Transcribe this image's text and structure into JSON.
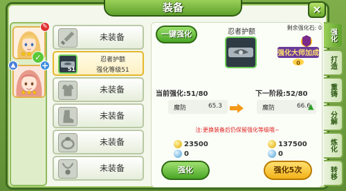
{
  "window": {
    "title": "装备",
    "close_glyph": "×"
  },
  "heroes": [
    {
      "name": "hero-1",
      "stars": "★★★"
    },
    {
      "name": "hero-2",
      "stars": "★★★"
    }
  ],
  "slots": [
    {
      "label": "未装备",
      "icon": "sword-icon"
    },
    {
      "label": "忍者护额",
      "sub": "强化等级51",
      "level": "51",
      "icon": "headband-icon",
      "selected": true
    },
    {
      "label": "未装备",
      "icon": "armor-icon"
    },
    {
      "label": "未装备",
      "icon": "boots-icon"
    },
    {
      "label": "未装备",
      "icon": "ring-icon"
    },
    {
      "label": "未装备",
      "icon": "necklace-icon"
    }
  ],
  "detail": {
    "onekey_label": "一键强化",
    "remain_label": "剩余强化石:",
    "remain_value": "0",
    "item_name": "忍者护额",
    "master_label": "强化大师加成",
    "master_value": "0",
    "current_level": "当前强化:51/80",
    "next_level": "下一阶段:52/80",
    "stat_key": "魔防",
    "stat_current": "65.3",
    "stat_next": "66.6",
    "note": "注:更换装备后仍保留强化等级哦~",
    "cost1_coin": "23500",
    "cost1_gem": "0",
    "cost5_coin": "137500",
    "cost5_gem": "0",
    "btn_strengthen": "强化",
    "btn_strengthen5": "强化5次"
  },
  "tabs": [
    "强化",
    "打造",
    "重铸",
    "分解",
    "炼化",
    "转移"
  ],
  "colors": {
    "accent": "#5ea12b",
    "selected_border": "#e5b72a",
    "warn": "#e02020",
    "up": "#2ea02a"
  }
}
